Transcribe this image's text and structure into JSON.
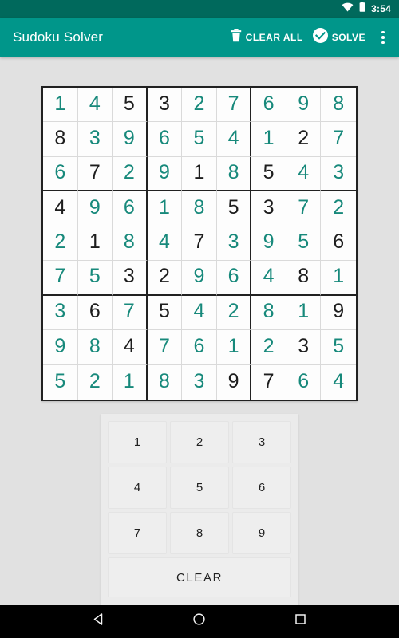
{
  "status_bar": {
    "time": "3:54",
    "wifi_icon": "wifi-icon",
    "battery_icon": "battery-icon",
    "background_color": "#00695c"
  },
  "app_bar": {
    "title": "Sudoku Solver",
    "background_color": "#00968a",
    "clear_all": {
      "label": "CLEAR ALL",
      "icon": "trash-icon"
    },
    "solve": {
      "label": "SOLVE",
      "icon": "check-circle-icon"
    },
    "overflow": {
      "icon": "more-vertical-icon"
    }
  },
  "colors": {
    "accent_teal": "#17897b",
    "given_black": "#1d1d1d",
    "page_background": "#e1e1e1",
    "grid_line": "#dadada",
    "grid_border": "#212121"
  },
  "grid": {
    "size": 9,
    "rows": [
      [
        {
          "value": "1",
          "type": "solved"
        },
        {
          "value": "4",
          "type": "solved"
        },
        {
          "value": "5",
          "type": "given"
        },
        {
          "value": "3",
          "type": "given"
        },
        {
          "value": "2",
          "type": "solved"
        },
        {
          "value": "7",
          "type": "solved"
        },
        {
          "value": "6",
          "type": "solved"
        },
        {
          "value": "9",
          "type": "solved"
        },
        {
          "value": "8",
          "type": "solved"
        }
      ],
      [
        {
          "value": "8",
          "type": "given"
        },
        {
          "value": "3",
          "type": "solved"
        },
        {
          "value": "9",
          "type": "solved"
        },
        {
          "value": "6",
          "type": "solved"
        },
        {
          "value": "5",
          "type": "solved"
        },
        {
          "value": "4",
          "type": "solved"
        },
        {
          "value": "1",
          "type": "solved"
        },
        {
          "value": "2",
          "type": "given"
        },
        {
          "value": "7",
          "type": "solved"
        }
      ],
      [
        {
          "value": "6",
          "type": "solved"
        },
        {
          "value": "7",
          "type": "given"
        },
        {
          "value": "2",
          "type": "solved"
        },
        {
          "value": "9",
          "type": "solved"
        },
        {
          "value": "1",
          "type": "given"
        },
        {
          "value": "8",
          "type": "solved"
        },
        {
          "value": "5",
          "type": "given"
        },
        {
          "value": "4",
          "type": "solved"
        },
        {
          "value": "3",
          "type": "solved"
        }
      ],
      [
        {
          "value": "4",
          "type": "given"
        },
        {
          "value": "9",
          "type": "solved"
        },
        {
          "value": "6",
          "type": "solved"
        },
        {
          "value": "1",
          "type": "solved"
        },
        {
          "value": "8",
          "type": "solved"
        },
        {
          "value": "5",
          "type": "given"
        },
        {
          "value": "3",
          "type": "given"
        },
        {
          "value": "7",
          "type": "solved"
        },
        {
          "value": "2",
          "type": "solved"
        }
      ],
      [
        {
          "value": "2",
          "type": "solved"
        },
        {
          "value": "1",
          "type": "given"
        },
        {
          "value": "8",
          "type": "solved"
        },
        {
          "value": "4",
          "type": "solved"
        },
        {
          "value": "7",
          "type": "given"
        },
        {
          "value": "3",
          "type": "solved"
        },
        {
          "value": "9",
          "type": "solved"
        },
        {
          "value": "5",
          "type": "solved"
        },
        {
          "value": "6",
          "type": "given"
        }
      ],
      [
        {
          "value": "7",
          "type": "solved"
        },
        {
          "value": "5",
          "type": "solved"
        },
        {
          "value": "3",
          "type": "given"
        },
        {
          "value": "2",
          "type": "given"
        },
        {
          "value": "9",
          "type": "solved"
        },
        {
          "value": "6",
          "type": "solved"
        },
        {
          "value": "4",
          "type": "solved"
        },
        {
          "value": "8",
          "type": "given"
        },
        {
          "value": "1",
          "type": "solved"
        }
      ],
      [
        {
          "value": "3",
          "type": "solved"
        },
        {
          "value": "6",
          "type": "given"
        },
        {
          "value": "7",
          "type": "solved"
        },
        {
          "value": "5",
          "type": "given"
        },
        {
          "value": "4",
          "type": "solved"
        },
        {
          "value": "2",
          "type": "solved"
        },
        {
          "value": "8",
          "type": "solved"
        },
        {
          "value": "1",
          "type": "solved"
        },
        {
          "value": "9",
          "type": "given"
        }
      ],
      [
        {
          "value": "9",
          "type": "solved"
        },
        {
          "value": "8",
          "type": "solved"
        },
        {
          "value": "4",
          "type": "given"
        },
        {
          "value": "7",
          "type": "solved"
        },
        {
          "value": "6",
          "type": "solved"
        },
        {
          "value": "1",
          "type": "solved"
        },
        {
          "value": "2",
          "type": "solved"
        },
        {
          "value": "3",
          "type": "given"
        },
        {
          "value": "5",
          "type": "solved"
        }
      ],
      [
        {
          "value": "5",
          "type": "solved"
        },
        {
          "value": "2",
          "type": "solved"
        },
        {
          "value": "1",
          "type": "solved"
        },
        {
          "value": "8",
          "type": "solved"
        },
        {
          "value": "3",
          "type": "solved"
        },
        {
          "value": "9",
          "type": "given"
        },
        {
          "value": "7",
          "type": "given"
        },
        {
          "value": "6",
          "type": "solved"
        },
        {
          "value": "4",
          "type": "solved"
        }
      ]
    ]
  },
  "keypad": {
    "keys": [
      "1",
      "2",
      "3",
      "4",
      "5",
      "6",
      "7",
      "8",
      "9"
    ],
    "clear_label": "CLEAR"
  },
  "nav_bar": {
    "back": "back-triangle-icon",
    "home": "home-circle-icon",
    "recents": "recents-square-icon"
  }
}
